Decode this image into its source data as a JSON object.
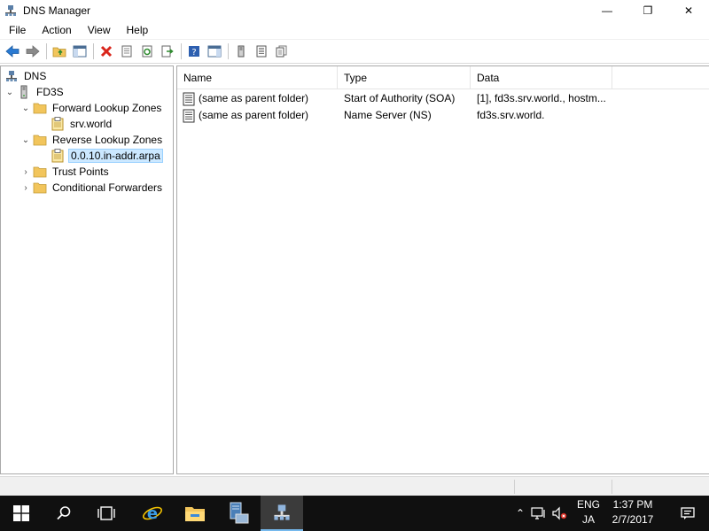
{
  "window": {
    "title": "DNS Manager",
    "minimize_glyph": "—",
    "maximize_glyph": "❐",
    "close_glyph": "✕"
  },
  "menu": [
    "File",
    "Action",
    "View",
    "Help"
  ],
  "tree": {
    "root": "DNS",
    "server": "FD3S",
    "forward_zones": "Forward Lookup Zones",
    "forward_zone_child": "srv.world",
    "reverse_zones": "Reverse Lookup Zones",
    "reverse_zone_child": "0.0.10.in-addr.arpa",
    "trust_points": "Trust Points",
    "conditional_forwarders": "Conditional Forwarders"
  },
  "list": {
    "columns": [
      "Name",
      "Type",
      "Data"
    ],
    "rows": [
      {
        "name": "(same as parent folder)",
        "type": "Start of Authority (SOA)",
        "data": "[1], fd3s.srv.world., hostm..."
      },
      {
        "name": "(same as parent folder)",
        "type": "Name Server (NS)",
        "data": "fd3s.srv.world."
      }
    ]
  },
  "taskbar": {
    "lang_top": "ENG",
    "lang_bottom": "JA",
    "time": "1:37 PM",
    "date": "2/7/2017"
  },
  "colors": {
    "accent": "#1e78d7",
    "selection": "#cce8ff",
    "taskbar": "#101010",
    "folder": "#f2c55c",
    "delete_red": "#d9261c"
  }
}
